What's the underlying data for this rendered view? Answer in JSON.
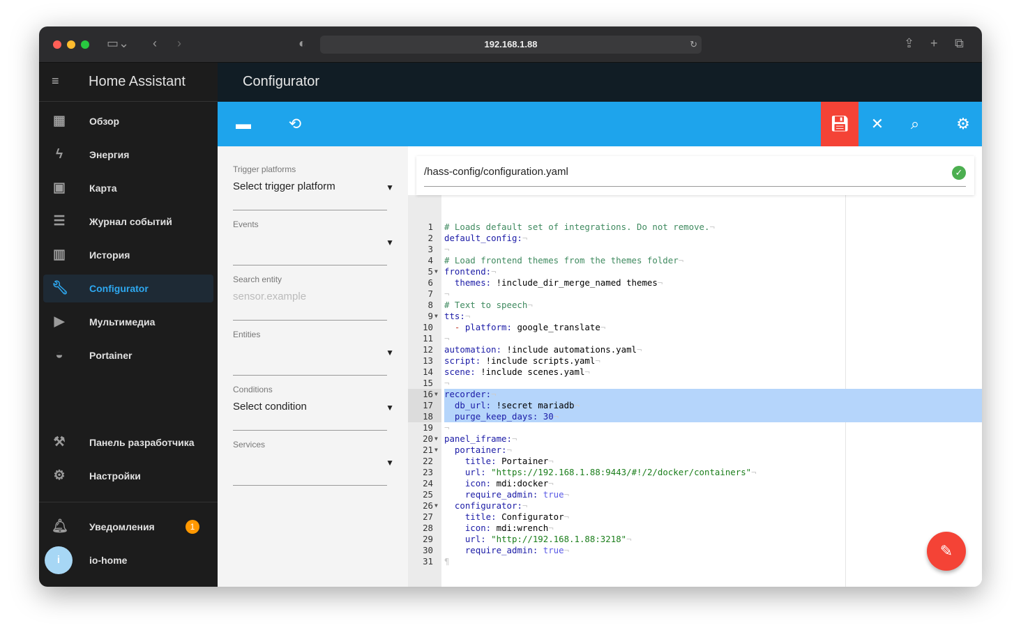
{
  "browser": {
    "url": "192.168.1.88"
  },
  "sidebar": {
    "title": "Home Assistant",
    "items": [
      {
        "label": "Обзор",
        "icon": "dashboard-icon"
      },
      {
        "label": "Энергия",
        "icon": "lightning-icon"
      },
      {
        "label": "Карта",
        "icon": "map-person-icon"
      },
      {
        "label": "Журнал событий",
        "icon": "list-icon"
      },
      {
        "label": "История",
        "icon": "chart-icon"
      },
      {
        "label": "Configurator",
        "icon": "wrench-icon"
      },
      {
        "label": "Мультимедиа",
        "icon": "media-icon"
      },
      {
        "label": "Portainer",
        "icon": "docker-icon"
      },
      {
        "label": "Панель разработчика",
        "icon": "hammer-icon"
      },
      {
        "label": "Настройки",
        "icon": "gear-icon"
      },
      {
        "label": "Уведомления",
        "icon": "bell-icon",
        "badge": "1"
      },
      {
        "label": "io-home",
        "avatar": "i"
      }
    ]
  },
  "header": {
    "title": "Configurator"
  },
  "form": {
    "trigger": {
      "label": "Trigger platforms",
      "value": "Select trigger platform"
    },
    "events": {
      "label": "Events",
      "value": ""
    },
    "search": {
      "label": "Search entity",
      "placeholder": "sensor.example"
    },
    "entities": {
      "label": "Entities",
      "value": ""
    },
    "conditions": {
      "label": "Conditions",
      "value": "Select condition"
    },
    "services": {
      "label": "Services",
      "value": ""
    }
  },
  "editor": {
    "path": "/hass-config/configuration.yaml",
    "selected_lines": [
      16,
      17,
      18
    ],
    "folds": [
      5,
      9,
      16,
      20,
      21,
      26
    ],
    "lines": [
      [
        [
          "c",
          "# Loads default set of integrations. Do not remove."
        ]
      ],
      [
        [
          "k",
          "default_config:"
        ]
      ],
      [],
      [
        [
          "c",
          "# Load frontend themes from the themes folder"
        ]
      ],
      [
        [
          "k",
          "frontend:"
        ]
      ],
      [
        [
          "p",
          "  "
        ],
        [
          "k",
          "themes:"
        ],
        [
          "p",
          " !include_dir_merge_named themes"
        ]
      ],
      [],
      [
        [
          "c",
          "# Text to speech"
        ]
      ],
      [
        [
          "k",
          "tts:"
        ]
      ],
      [
        [
          "p",
          "  "
        ],
        [
          "d",
          "- "
        ],
        [
          "k",
          "platform:"
        ],
        [
          "p",
          " google_translate"
        ]
      ],
      [],
      [
        [
          "k",
          "automation:"
        ],
        [
          "p",
          " !include automations.yaml"
        ]
      ],
      [
        [
          "k",
          "script:"
        ],
        [
          "p",
          " !include scripts.yaml"
        ]
      ],
      [
        [
          "k",
          "scene:"
        ],
        [
          "p",
          " !include scenes.yaml"
        ]
      ],
      [],
      [
        [
          "k",
          "recorder:"
        ]
      ],
      [
        [
          "p",
          "  "
        ],
        [
          "k",
          "db_url:"
        ],
        [
          "p",
          " !secret mariadb"
        ]
      ],
      [
        [
          "p",
          "  "
        ],
        [
          "k",
          "purge_keep_days:"
        ],
        [
          "p",
          " "
        ],
        [
          "n",
          "30"
        ]
      ],
      [],
      [
        [
          "k",
          "panel_iframe:"
        ]
      ],
      [
        [
          "p",
          "  "
        ],
        [
          "k",
          "portainer:"
        ]
      ],
      [
        [
          "p",
          "    "
        ],
        [
          "k",
          "title:"
        ],
        [
          "p",
          " Portainer"
        ]
      ],
      [
        [
          "p",
          "    "
        ],
        [
          "k",
          "url:"
        ],
        [
          "p",
          " "
        ],
        [
          "s",
          "\"https://192.168.1.88:9443/#!/2/docker/containers\""
        ]
      ],
      [
        [
          "p",
          "    "
        ],
        [
          "k",
          "icon:"
        ],
        [
          "p",
          " mdi:docker"
        ]
      ],
      [
        [
          "p",
          "    "
        ],
        [
          "k",
          "require_admin:"
        ],
        [
          "p",
          " "
        ],
        [
          "b",
          "true"
        ]
      ],
      [
        [
          "p",
          "  "
        ],
        [
          "k",
          "configurator:"
        ]
      ],
      [
        [
          "p",
          "    "
        ],
        [
          "k",
          "title:"
        ],
        [
          "p",
          " Configurator"
        ]
      ],
      [
        [
          "p",
          "    "
        ],
        [
          "k",
          "icon:"
        ],
        [
          "p",
          " mdi:wrench"
        ]
      ],
      [
        [
          "p",
          "    "
        ],
        [
          "k",
          "url:"
        ],
        [
          "p",
          " "
        ],
        [
          "s",
          "\"http://192.168.1.88:3218\""
        ]
      ],
      [
        [
          "p",
          "    "
        ],
        [
          "k",
          "require_admin:"
        ],
        [
          "p",
          " "
        ],
        [
          "b",
          "true"
        ]
      ],
      []
    ]
  },
  "colors": {
    "toolbar": "#1ea4ec",
    "save": "#f44336",
    "active": "#2ea8f0"
  }
}
